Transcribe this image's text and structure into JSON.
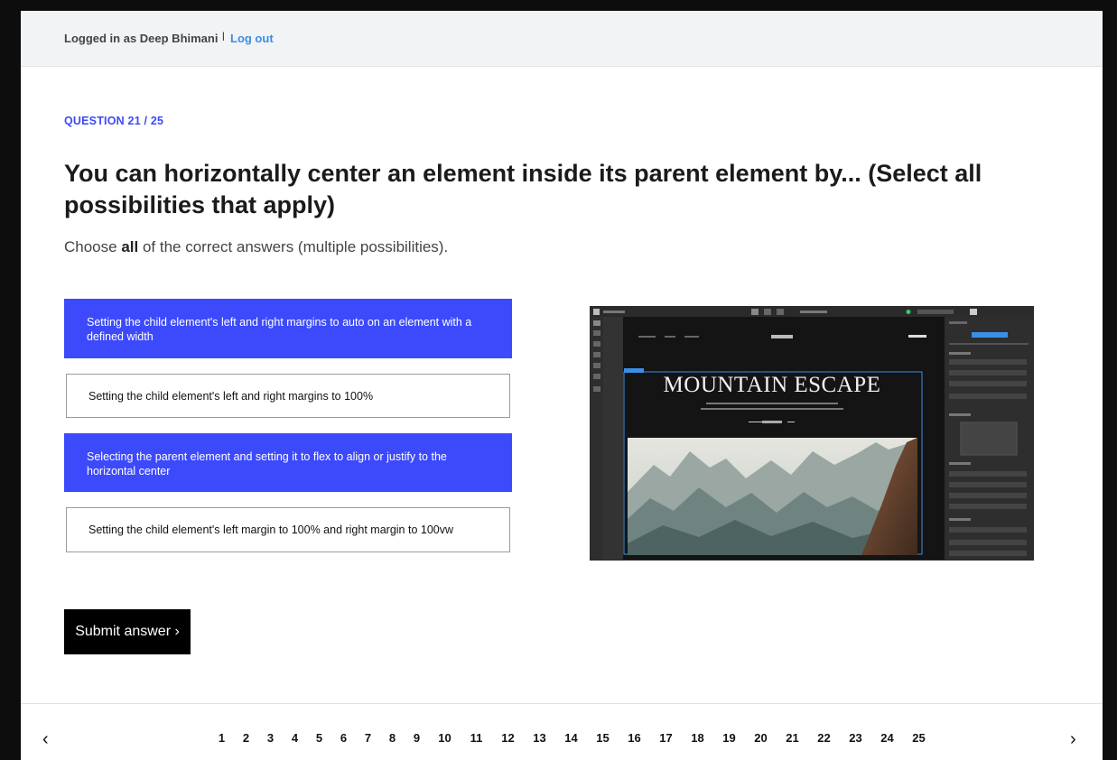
{
  "header": {
    "logged_in_text": "Logged in as Deep Bhimani",
    "separator": "l",
    "logout_label": "Log out"
  },
  "question": {
    "number_label": "QUESTION 21 / 25",
    "title": "You can horizontally center an element inside its parent element by... (Select all possibilities that apply)",
    "instruction_prefix": "Choose ",
    "instruction_bold": "all",
    "instruction_suffix": " of the correct answers (multiple possibilities)."
  },
  "answers": [
    {
      "label": "Setting the child element's left and right margins to auto on an element with a defined width",
      "selected": true
    },
    {
      "label": "Setting the child element's left and right margins to 100%",
      "selected": false
    },
    {
      "label": "Selecting the parent element and setting it to flex to align or justify to the horizontal center",
      "selected": true
    },
    {
      "label": "Setting the child element's left margin to 100% and right margin to 100vw",
      "selected": false
    }
  ],
  "screenshot": {
    "nav_links": [
      "Projects",
      "About",
      "Support"
    ],
    "site_logo": "MY SITE",
    "nav_cta": "Book now",
    "hero_title": "MOUNTAIN ESCAPE",
    "hero_text_1": "Aenean eu leo quam. Pellentesque ornare sem lacinia quam venenatis",
    "hero_text_2": "vestibulum. Duis aute irure dolor in reprehenderit in voluptate nulla pariatur.",
    "hero_cta": "DISCOVER",
    "selection_tag": "Container"
  },
  "submit_label": "Submit answer ›",
  "pager": {
    "prev": "‹",
    "next": "›",
    "pages": [
      "1",
      "2",
      "3",
      "4",
      "5",
      "6",
      "7",
      "8",
      "9",
      "10",
      "11",
      "12",
      "13",
      "14",
      "15",
      "16",
      "17",
      "18",
      "19",
      "20",
      "21",
      "22",
      "23",
      "24",
      "25"
    ],
    "current": "21"
  },
  "colors": {
    "accent": "#3c4afc",
    "link": "#3b8ee6"
  }
}
